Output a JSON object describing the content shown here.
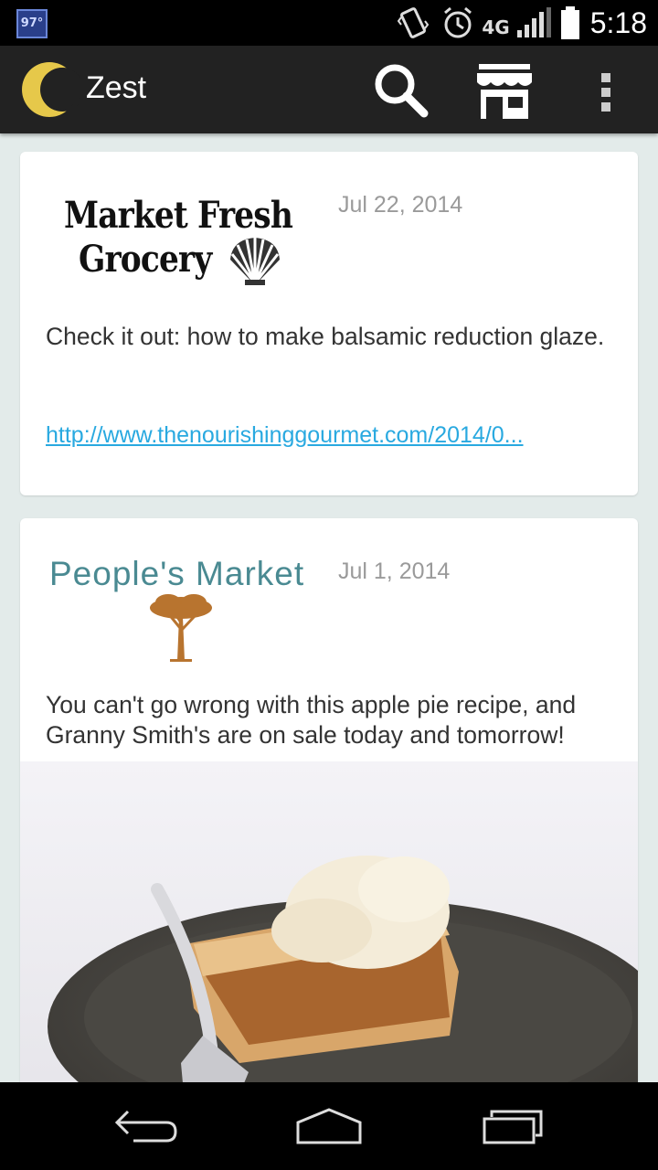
{
  "status_bar": {
    "weather_temp": "97°",
    "network_type": "4G",
    "time": "5:18"
  },
  "action_bar": {
    "app_title": "Zest",
    "icons": [
      "app-logo-icon",
      "search-icon",
      "store-icon",
      "overflow-menu-icon"
    ]
  },
  "feed": {
    "posts": [
      {
        "store_logo_text_line1": "Market Fresh",
        "store_logo_text_line2": "Grocery",
        "date": "Jul 22, 2014",
        "text": "Check it out: how to make balsamic reduction glaze.",
        "link": "http://www.thenourishinggourmet.com/2014/0..."
      },
      {
        "store_logo_text": "People's Market",
        "date": "Jul 1, 2014",
        "text": "You can't go wrong with this apple pie recipe, and Granny Smith's are on sale today and tomorrow!"
      }
    ]
  },
  "colors": {
    "action_bar_bg": "#222222",
    "feed_bg": "#e3ebea",
    "link": "#29a9e0",
    "peoples_market_teal": "#4a8a92",
    "tree_brown": "#b8742f"
  },
  "nav_bar": {
    "icons": [
      "back-icon",
      "home-icon",
      "recents-icon"
    ]
  }
}
